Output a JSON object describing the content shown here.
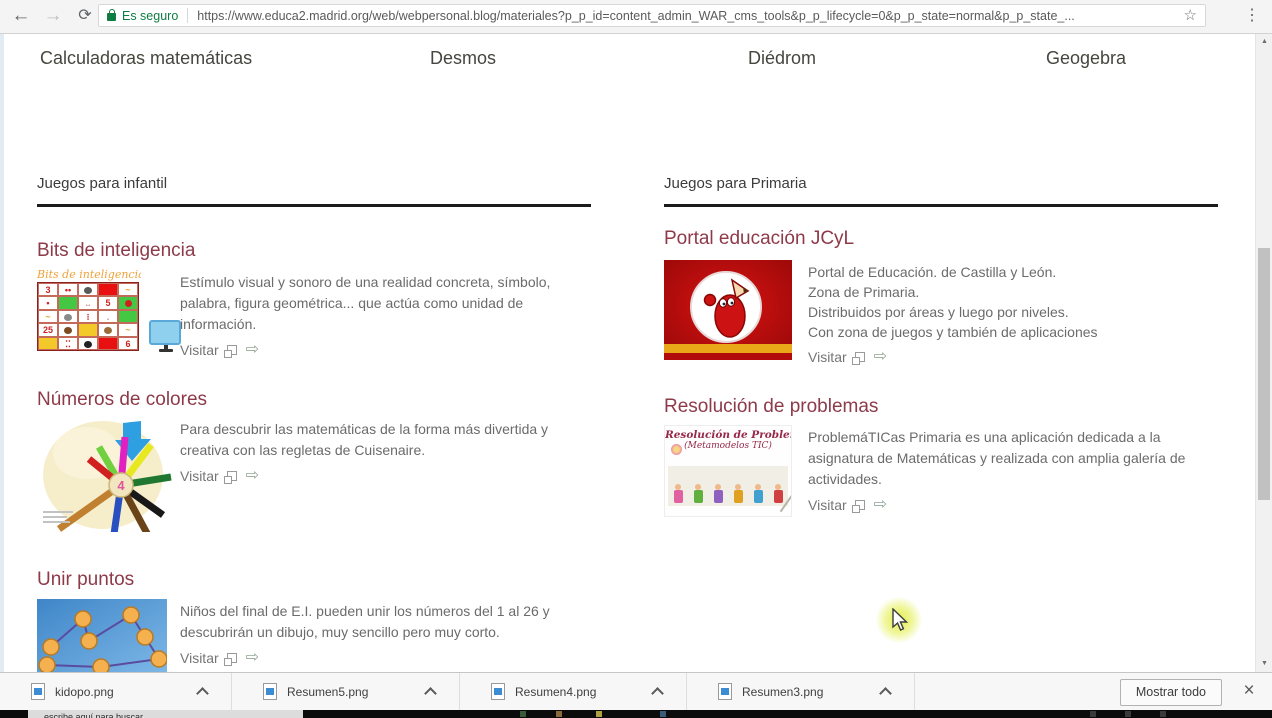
{
  "browser": {
    "security_label": "Es seguro",
    "url": "https://www.educa2.madrid.org/web/webpersonal.blog/materiales?p_p_id=content_admin_WAR_cms_tools&p_p_lifecycle=0&p_p_state=normal&p_p_state_..."
  },
  "nav_links": [
    "Calculadoras matemáticas",
    "Desmos",
    "Diédrom",
    "Geogebra"
  ],
  "sections": {
    "infantil": {
      "heading": "Juegos para infantil",
      "items": [
        {
          "title": "Bits de inteligencia",
          "description": "Estímulo visual y sonoro de una realidad concreta, símbolo, palabra, figura geométrica... que actúa como unidad de información.",
          "link": "Visitar",
          "thumb_caption": "Bits de inteligencia",
          "thumb_numbers": [
            "3",
            "5",
            "25",
            "6"
          ]
        },
        {
          "title": "Números de colores",
          "description": "Para descubrir las matemáticas de la forma más divertida y creativa con las regletas de Cuisenaire.",
          "link": "Visitar",
          "thumb_number": "4"
        },
        {
          "title": "Unir puntos",
          "description": "Niños del final de E.I. pueden unir los números del 1 al 26 y descubrirán un dibujo, muy sencillo pero muy corto.",
          "link": "Visitar"
        }
      ]
    },
    "primaria": {
      "heading": "Juegos para Primaria",
      "items": [
        {
          "title": "Portal educación JCyL",
          "lines": [
            "Portal de Educación. de Castilla y León.",
            "Zona de Primaria.",
            "Distribuidos por áreas y luego por niveles.",
            "Con zona de juegos y también de aplicaciones"
          ],
          "link": "Visitar"
        },
        {
          "title": "Resolución de problemas",
          "description": "ProblemáTICas Primaria es una aplicación dedicada a la asignatura de Matemáticas y realizada con amplia galería de actividades.",
          "link": "Visitar",
          "thumb_lines": [
            "Resolución de Problemas",
            "(Metamodelos TIC)"
          ]
        }
      ]
    }
  },
  "downloads": {
    "files": [
      {
        "name": "kidopo.png"
      },
      {
        "name": "Resumen5.png"
      },
      {
        "name": "Resumen4.png"
      },
      {
        "name": "Resumen3.png"
      }
    ],
    "show_all_label": "Mostrar todo"
  },
  "taskbar": {
    "search_hint": "escribe aquí para buscar"
  },
  "colors": {
    "title_link": "#8d3a49",
    "nav_link": "#46463f",
    "secure_green": "#0e7d41",
    "heading_rule": "#1b1b1b",
    "shelf_bg": "#f7f7f7"
  }
}
